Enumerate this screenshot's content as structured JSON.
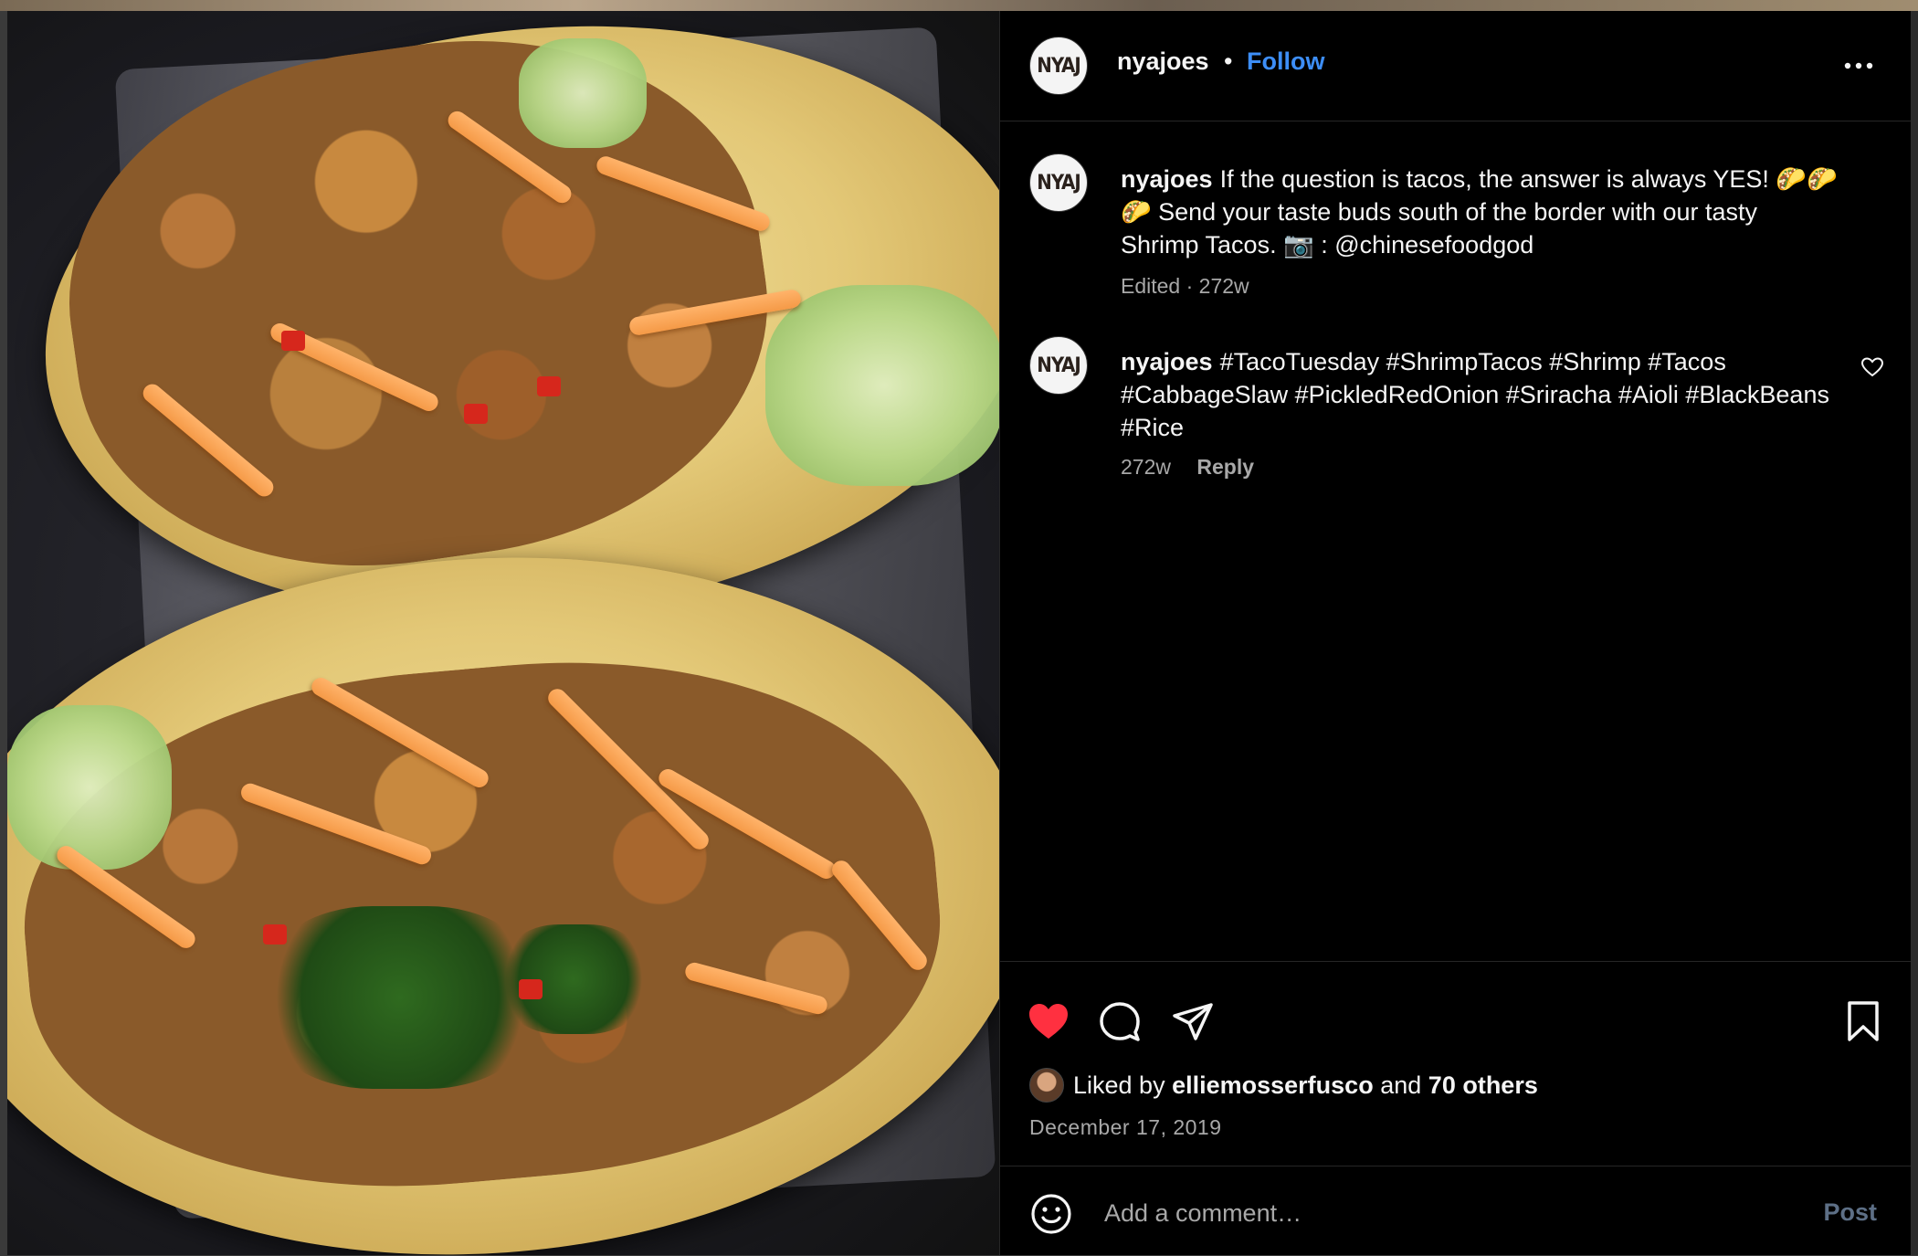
{
  "post": {
    "image_alt": "Shrimp tacos"
  },
  "header": {
    "avatar_text": "NYAJ",
    "username": "nyajoes",
    "separator": "•",
    "follow_label": "Follow",
    "more_icon": "more-horizontal-icon"
  },
  "caption": {
    "avatar_text": "NYAJ",
    "username": "nyajoes",
    "text": "If the question is tacos, the answer is always YES! 🌮🌮🌮 Send your taste buds south of the border with our tasty Shrimp Tacos. 📷 : @chinesefoodgod",
    "meta": "Edited · 272w"
  },
  "hashtag_comment": {
    "avatar_text": "NYAJ",
    "username": "nyajoes",
    "text": "#TacoTuesday #ShrimpTacos #Shrimp #Tacos #CabbageSlaw #PickledRedOnion #Sriracha #Aioli #BlackBeans #Rice",
    "time": "272w",
    "reply_label": "Reply",
    "like_icon": "heart-outline-icon"
  },
  "actions": {
    "like_icon": "heart-filled-icon",
    "comment_icon": "comment-icon",
    "share_icon": "send-icon",
    "save_icon": "bookmark-icon",
    "like_color": "#ff3040"
  },
  "likes": {
    "prefix": "Liked by",
    "user": "elliemosserfusco",
    "conjunction": "and",
    "others": "70 others"
  },
  "date": "December 17, 2019",
  "composer": {
    "emoji_icon": "smiley-icon",
    "placeholder": "Add a comment…",
    "post_label": "Post"
  },
  "colors": {
    "background": "#000000",
    "link_blue": "#3d8ef7",
    "muted_text": "#a8a8a8",
    "post_disabled": "#5d6f86"
  }
}
